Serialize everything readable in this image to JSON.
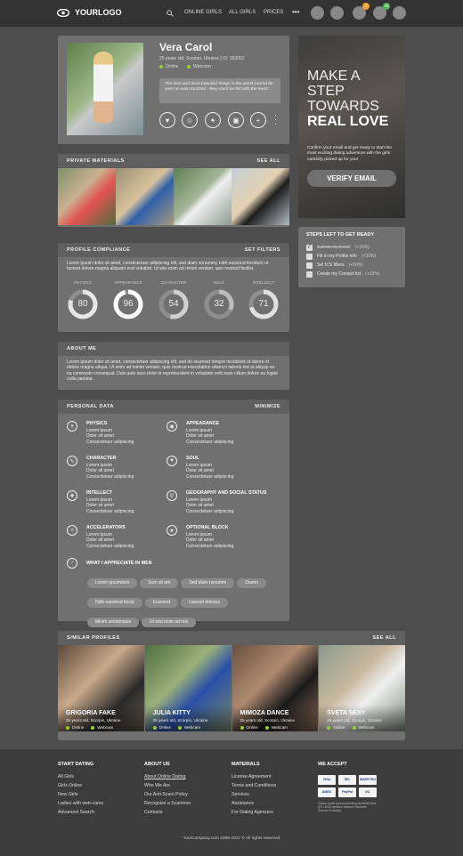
{
  "header": {
    "logo": "YOURLOGO",
    "nav": [
      "ONLINE GIRLS",
      "ALL GIRLS",
      "PRICES"
    ],
    "more": "•••",
    "badges": {
      "notifications": "3",
      "credits": "48"
    }
  },
  "profile": {
    "name": "Vera Carol",
    "meta": "25 years old, Scorpio, Ukraine | ID: 353052",
    "status_online": "Online",
    "status_webcam": "Webcam",
    "quote": "The best and most beautiful things in the world cannot be seen or even touched - they must be felt with the heart."
  },
  "promo": {
    "line1": "MAKE A",
    "line2": "STEP",
    "line3": "TOWARDS",
    "line4": "REAL LOVE",
    "text": "Confirm your email and get ready to start the most exciting dating adventure with the girls carefully picked up for you!",
    "button": "VERIFY EMAIL"
  },
  "steps": {
    "title": "STEPS LEFT TO GET READY",
    "items": [
      {
        "label": "Submit my Email",
        "bonus": "(+15%)",
        "done": true
      },
      {
        "label": "Fill in my Profile info",
        "bonus": "(+30%)",
        "done": false
      },
      {
        "label": "Set ICS filters",
        "bonus": "(+50%)",
        "done": false
      },
      {
        "label": "Create my Contact list",
        "bonus": "(+15%)",
        "done": false
      }
    ]
  },
  "private": {
    "title": "PRIVATE MATERIALS",
    "action": "SEE ALL"
  },
  "compliance": {
    "title": "PROFILE COMPLIANCE",
    "action": "SET FILTERS",
    "text": "Lorem ipsum dolor sit amet, consectetuer adipiscing elit, sed diam nonummy nibh euismod tincidunt ut laoreet dolore magna aliquam erat volutpat. Ut wisi enim ad minim veniam, quis nostrud facilisi.",
    "rings": [
      {
        "label": "PHYSICS",
        "value": "80",
        "pct": 0.8,
        "color": "#e6e6e6"
      },
      {
        "label": "APPEARANCE",
        "value": "96",
        "pct": 0.96,
        "color": "#ffffff"
      },
      {
        "label": "CHARACTER",
        "value": "54",
        "pct": 0.54,
        "color": "#d0d0d0"
      },
      {
        "label": "SOUL",
        "value": "32",
        "pct": 0.32,
        "color": "#bdbdbd"
      },
      {
        "label": "INTELLECT",
        "value": "71",
        "pct": 0.71,
        "color": "#e0e0e0"
      }
    ]
  },
  "about": {
    "title": "ABOUT ME",
    "text": "Lorem ipsum dolor sit amet, consectetuer adipiscing elit, sed do eiusmod tempor incididunt ut labore et dolore magna aliqua. Ut enim ad minim veniam, quis nostrud exercitation ullamco laboris nisi ut aliquip ex ea commodo consequat. Duis aute irure dolor in reprehenderit in voluptate velit esse cillum dolore eu fugiat nulla pariatur."
  },
  "personal": {
    "title": "PERSONAL DATA",
    "action": "MINIMIZE",
    "blocks": [
      {
        "title": "PHYSICS",
        "l1": "Lorem ipsum",
        "l2": "Dolor sit amet",
        "l3": "Consectetuer adipiscing",
        "icon": "body-icon"
      },
      {
        "title": "APPEARANCE",
        "l1": "Lorem ipsum",
        "l2": "Dolor sit amet",
        "l3": "Consectetuer adipiscing",
        "icon": "eye-icon"
      },
      {
        "title": "CHARACTER",
        "l1": "Lorem ipsum",
        "l2": "Dolor sit amet",
        "l3": "Consectetuer adipiscing",
        "icon": "character-icon"
      },
      {
        "title": "SOUL",
        "l1": "Lorem ipsum",
        "l2": "Dolor sit amet",
        "l3": "Consectetuer adipiscing",
        "icon": "heart-icon"
      },
      {
        "title": "INTELLECT",
        "l1": "Lorem ipsum",
        "l2": "Dolor sit amet",
        "l3": "Consectetuer adipiscing",
        "icon": "puzzle-icon"
      },
      {
        "title": "GEOGRAPHY AND SOCIAL STATUS",
        "l1": "Lorem ipsum",
        "l2": "Dolor sit amet",
        "l3": "Consectetuer adipiscing",
        "icon": "location-icon"
      },
      {
        "title": "ACCELERATORS",
        "l1": "Lorem ipsum",
        "l2": "Dolor sit amet",
        "l3": "Consectetuer adipiscing",
        "icon": "fast-forward-icon"
      },
      {
        "title": "OPTIONAL BLOCK",
        "l1": "Lorem ipsum",
        "l2": "Dolor sit amet",
        "l3": "Consectetuer adipiscing",
        "icon": "star-icon"
      }
    ],
    "appreciate_title": "WHAT I APPRECIATE IN MEN",
    "tags": [
      "Lorem ipsumdolo",
      "Sum sit am",
      "Sed diam nonumm",
      "Diamn",
      "Nibh euismod tincid",
      "Euismod",
      "Laoreet dolores",
      "Minim veniamquis",
      "Ut wisi enim ad min"
    ]
  },
  "similar": {
    "title": "SIMILAR PROFILES",
    "action": "SEE ALL",
    "items": [
      {
        "name": "GRIGORIA FAKE",
        "meta": "25 years old, Scorpio, Ukraine",
        "online": "Online",
        "webcam": "Webcam"
      },
      {
        "name": "JULIA KITTY",
        "meta": "25 years old, Scorpio, Ukraine",
        "online": "Online",
        "webcam": "Webcam"
      },
      {
        "name": "MIMOZA DANCE",
        "meta": "25 years old, Scorpio, Ukraine",
        "online": "Online",
        "webcam": "Webcam"
      },
      {
        "name": "SVETA SEXY",
        "meta": "25 years old, Scorpio, Ukraine",
        "online": "Online",
        "webcam": "Webcam"
      }
    ]
  },
  "footer": {
    "cols": [
      {
        "title": "START DATING",
        "links": [
          "All Girls",
          "Girls Online",
          "New Girls",
          "Ladies with web-cams",
          "Advanced Search"
        ]
      },
      {
        "title": "ABOUT US",
        "links": [
          "About Online Dating",
          "Who We Are",
          "Our Anti-Scam Policy",
          "Recognize a Scammer",
          "Contacts"
        ]
      },
      {
        "title": "MATERIALS",
        "links": [
          "License Agreement",
          "Terms and Conditions",
          "Services",
          "Assistance",
          "For Dating Agencies"
        ]
      }
    ],
    "accept_title": "WE ACCEPT",
    "cards": [
      "VISA",
      "MC",
      "MAESTRO",
      "AMEX",
      "PayPal",
      "DC"
    ],
    "accept_note": "Online credit card processing by MultiCards (PCI-DSS certified Internet Payment Service Provider)",
    "copyright": "YourCompany.com 2008-2017 © All rights reserved"
  }
}
